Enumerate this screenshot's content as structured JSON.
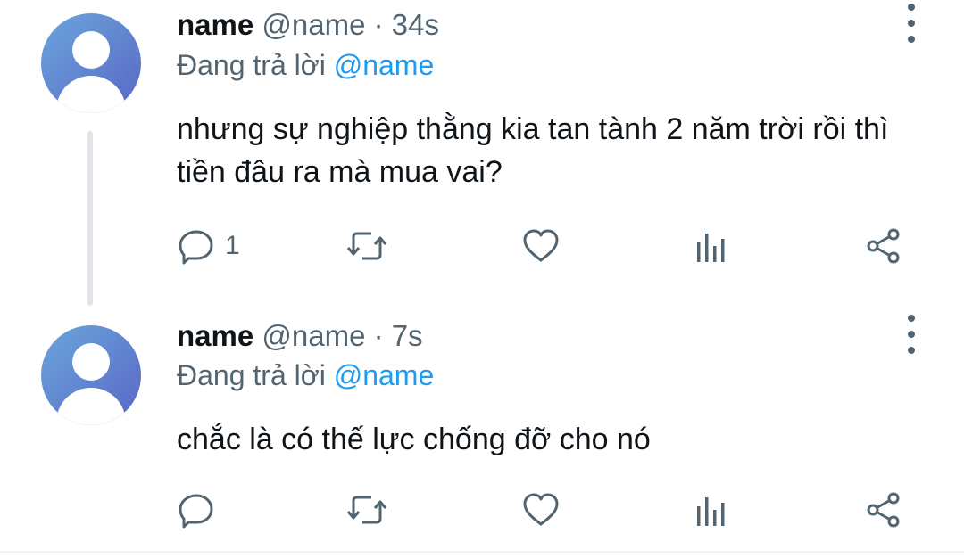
{
  "colors": {
    "text_primary": "#0f1419",
    "text_secondary": "#536471",
    "mention": "#1d9bf0",
    "avatar_gradient_start": "#6aa6dc",
    "avatar_gradient_end": "#5a66c4"
  },
  "tweets": [
    {
      "name": "name",
      "handle": "@name",
      "separator": "·",
      "time": "34s",
      "reply_prefix": "Đang trả lời",
      "reply_mention": "@name",
      "text": "nhưng sự nghiệp thằng kia tan tành 2 năm trời rồi thì tiền đâu ra mà mua vai?",
      "reply_count": "1",
      "icons": [
        "reply-icon",
        "retweet-icon",
        "like-icon",
        "views-icon",
        "share-icon"
      ]
    },
    {
      "name": "name",
      "handle": "@name",
      "separator": "·",
      "time": "7s",
      "reply_prefix": "Đang trả lời",
      "reply_mention": "@name",
      "text": "chắc là có thế lực chống đỡ cho nó",
      "reply_count": "",
      "icons": [
        "reply-icon",
        "retweet-icon",
        "like-icon",
        "views-icon",
        "share-icon"
      ]
    }
  ]
}
